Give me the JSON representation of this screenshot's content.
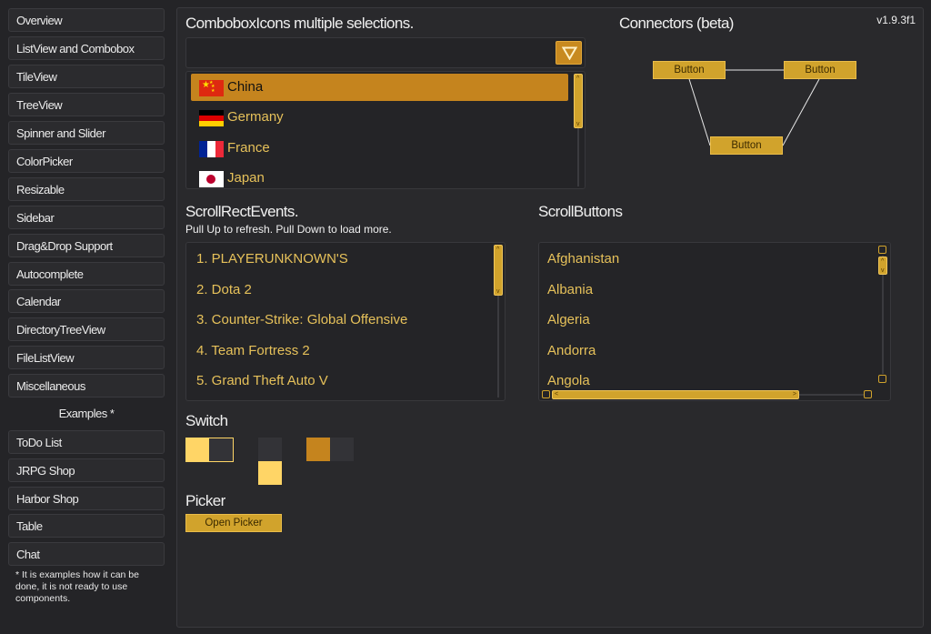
{
  "sidebar": {
    "items": [
      {
        "label": "Overview"
      },
      {
        "label": "ListView and Combobox"
      },
      {
        "label": "TileView"
      },
      {
        "label": "TreeView"
      },
      {
        "label": "Spinner and Slider"
      },
      {
        "label": "ColorPicker"
      },
      {
        "label": "Resizable"
      },
      {
        "label": "Sidebar"
      },
      {
        "label": "Drag&Drop Support"
      },
      {
        "label": "Autocomplete"
      },
      {
        "label": "Calendar"
      },
      {
        "label": "DirectoryTreeView"
      },
      {
        "label": "FileListView"
      },
      {
        "label": "Miscellaneous"
      }
    ],
    "examples_header": "Examples *",
    "examples": [
      {
        "label": "ToDo List"
      },
      {
        "label": "JRPG Shop"
      },
      {
        "label": "Harbor Shop"
      },
      {
        "label": "Table"
      },
      {
        "label": "Chat"
      }
    ],
    "note": "* It is examples how it can be done, it is not ready to use components."
  },
  "version": "v1.9.3f1",
  "combobox": {
    "title": "ComboboxIcons multiple selections.",
    "value": "",
    "items": [
      {
        "label": "China",
        "flag": "china-flag-icon",
        "selected": true
      },
      {
        "label": "Germany",
        "flag": "germany-flag-icon",
        "selected": false
      },
      {
        "label": "France",
        "flag": "france-flag-icon",
        "selected": false
      },
      {
        "label": "Japan",
        "flag": "japan-flag-icon",
        "selected": false
      }
    ]
  },
  "connectors": {
    "title": "Connectors (beta)",
    "buttons": [
      "Button",
      "Button",
      "Button"
    ]
  },
  "scroll_rect_events": {
    "title": "ScrollRectEvents.",
    "subtitle": "Pull Up to refresh. Pull Down to load more.",
    "items": [
      "1. PLAYERUNKNOWN'S",
      "2. Dota 2",
      "3. Counter-Strike: Global Offensive",
      "4. Team Fortress 2",
      "5. Grand Theft Auto V"
    ]
  },
  "scroll_buttons": {
    "title": "ScrollButtons",
    "items": [
      "Afghanistan",
      "Albania",
      "Algeria",
      "Andorra",
      "Angola"
    ]
  },
  "switch": {
    "title": "Switch",
    "states": [
      true,
      true,
      false
    ]
  },
  "picker": {
    "title": "Picker",
    "button_label": "Open Picker"
  },
  "colors": {
    "accent": "#d1a32c",
    "selected_row": "#c5841e",
    "list_text": "#e6c15a",
    "switch_on": "#ffd566",
    "switch_dark": "#c5841e",
    "background": "#242427"
  }
}
